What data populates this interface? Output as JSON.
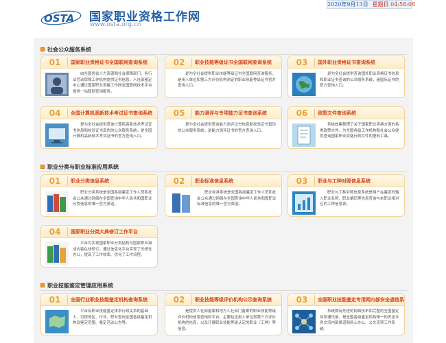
{
  "header": {
    "logo_text": "OSTA",
    "title": "国家职业资格工作网",
    "url": "www.osta.org.cn",
    "date": "2020年9月13日",
    "time": "星期日 04:58:08"
  },
  "colors": {
    "accent": "#f29a1d",
    "title": "#d2451f",
    "brand": "#1f5fa6"
  },
  "sections": [
    {
      "title": "社会公众服务系统",
      "cards": [
        {
          "num": "01",
          "title": "国家职业资格证书全国联网查询系统",
          "desc": "由全国各省人力资源和社会保障部门、各行业劳动保障工作机构提供证书信息，人社部鉴定中心通过国家职业资格工作网全国联网技术平台提供一站联网查询服务。",
          "thumb": "person-photo-icon"
        },
        {
          "num": "02",
          "title": "职业技能等级证书全国联网查询系统",
          "desc": "是为全社会提供职业技能等级证书全国联网查询服务，是用人单位和第三方评价机构测定的职业技能等级证书官方查询入口。",
          "thumb": "blank-thumb"
        },
        {
          "num": "03",
          "title": "国外职业资格证书查询系统",
          "desc": "是为全社会提供查询国外职业资格证书信息和职业证书查询的公众服务系统，是国际证书的官方查询入口。",
          "thumb": "globe-icon"
        },
        {
          "num": "04",
          "title": "全国计算机高新技术考试证书查询系统",
          "desc": "是为全社会提供查询计算机高新技术考试证书信息和校验证书真伪的公众服务系统，是全国计算机高新技术考试证书的官方查询入口。",
          "thumb": "computer-icon"
        },
        {
          "num": "05",
          "title": "能力测评与专项能力证书查询系统",
          "desc": "是为全社会提供查询能力测评证书信息和校验证书真伪的公众服务系统，是能力测评证书的官方查询入口。",
          "thumb": "blank-thumb"
        },
        {
          "num": "06",
          "title": "政策文件查询系统",
          "desc": "系统收集整理了关于国家职业资格方面的各类政策文件，为全国各级工作机构和社会公众提供查询国家职业资格行政文件的便利工具。",
          "thumb": "document-icon"
        }
      ]
    },
    {
      "title": "职业分类与职业标准应用系统",
      "cards": [
        {
          "num": "01",
          "title": "职业分类信息系统",
          "desc": "职业分类系统是全国各级鉴定工作人员和社会公众通过网络在全国查询中华人民共和国职业分类信息的唯一官方渠道。",
          "thumb": "books-icon"
        },
        {
          "num": "02",
          "title": "职业标准信息系统",
          "desc": "职业标准系统是全国各级鉴定工作人员和社会公众通过网络在全国查询中华人民共和国职业标准信息的唯一官方渠道。",
          "thumb": "standards-icon"
        },
        {
          "num": "03",
          "title": "职业与工种对照信息系统",
          "desc": "职业与工种对照信息系统是用户在鉴定时输入职业名称、职业编码等信息查询与本职业相对应的工种信息表。",
          "thumb": "chart-icon"
        },
        {
          "num": "04",
          "title": "国家职业分类大典修订工作平台",
          "desc": "平台可实现国家职业分类结构与国家职业描述内容在线修订，通过信息化平台实现了无纸化办公，提高了工作效率、优化了工作流程。",
          "thumb": "books-icon"
        }
      ]
    },
    {
      "title": "职业技能鉴定管理应用系统",
      "cards": [
        {
          "num": "01",
          "title": "全国行业职业技能鉴定机构查询系统",
          "desc": "平台有职业技能鉴定体系行政关系的基础上，可按地区、行业、职业查询全国各级鉴定机构及鉴定范围、鉴定活动公告等。",
          "thumb": "map-icon"
        },
        {
          "num": "02",
          "title": "职业技能等级评价机构公示查询系统",
          "desc": "是提供人社部备案和地方人社部门备案的职业技能等级评价机构信息查询的平台，主要包含用人单位和第三方评价机构的信息，以及开展职业技能等级认定的职业（工种）等信息。",
          "thumb": "blank-thumb"
        },
        {
          "num": "03",
          "title": "全国职业技能鉴定专用网内部安全通信系统",
          "desc": "系统拥有先进的网络技术和完整的全国鉴定体系通讯录，是全国各级鉴定机构唯一的安全业务交流内部渠道和网上办公、公文流转工作系统。",
          "thumb": "network-icon"
        }
      ]
    }
  ]
}
